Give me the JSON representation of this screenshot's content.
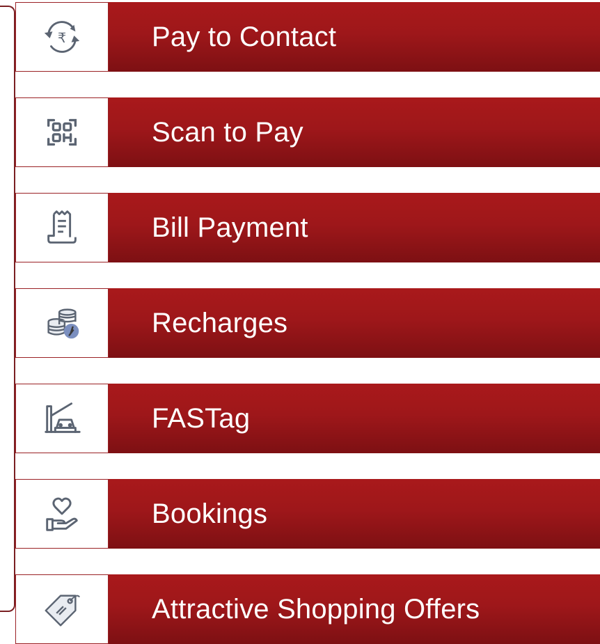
{
  "menu": {
    "items": [
      {
        "label": "Pay to Contact",
        "icon": "rupee-exchange-icon"
      },
      {
        "label": "Scan to Pay",
        "icon": "qr-scan-icon"
      },
      {
        "label": "Bill Payment",
        "icon": "bill-receipt-icon"
      },
      {
        "label": "Recharges",
        "icon": "coins-recharge-icon"
      },
      {
        "label": "FASTag",
        "icon": "toll-car-icon"
      },
      {
        "label": "Bookings",
        "icon": "heart-hand-icon"
      },
      {
        "label": "Attractive Shopping Offers",
        "icon": "price-tag-icon"
      }
    ]
  },
  "colors": {
    "bar_top": "#a9191b",
    "bar_bottom": "#7d1013",
    "icon_stroke": "#5b6472",
    "icon_accent": "#7b8fbf",
    "bracket": "#7a1f22"
  }
}
